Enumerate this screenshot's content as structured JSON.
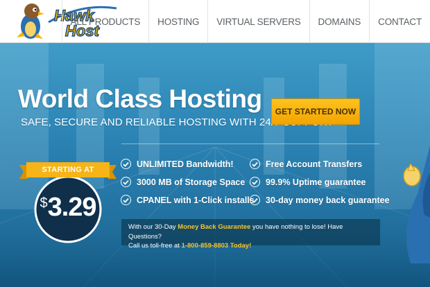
{
  "brand": {
    "name": "Hawk Host",
    "logo_text_line1": "Hawk",
    "logo_text_line2": "Host"
  },
  "nav": [
    {
      "label": "ALL PRODUCTS"
    },
    {
      "label": "HOSTING"
    },
    {
      "label": "VIRTUAL SERVERS"
    },
    {
      "label": "DOMAINS"
    },
    {
      "label": "CONTACT"
    }
  ],
  "hero": {
    "headline": "World Class Hosting",
    "subheadline": "SAFE, SECURE AND RELIABLE HOSTING WITH 24/7 SUPPORT",
    "cta_label": "GET STARTED NOW"
  },
  "pricing": {
    "ribbon": "STARTING AT",
    "currency": "$",
    "amount": "3.29"
  },
  "features": {
    "left": [
      {
        "label": "UNLIMITED Bandwidth!"
      },
      {
        "label": "3000 MB of Storage Space"
      },
      {
        "label": "CPANEL with 1-Click installs"
      }
    ],
    "right": [
      {
        "label": "Free Account Transfers"
      },
      {
        "label": "99.9% Uptime guarantee"
      },
      {
        "label": "30-day money back guarantee"
      }
    ]
  },
  "guarantee": {
    "line1_prefix": "With our 30-Day ",
    "line1_highlight": "Money Back Guarantee",
    "line1_suffix": " you have nothing to lose! Have Questions?",
    "line2_prefix": "Call us toll-free at ",
    "line2_highlight": "1-800-859-8803 Today!"
  },
  "colors": {
    "accent_yellow": "#f6c42d",
    "cta_bg": "#ffb80f",
    "hero_blue": "#2d86b6",
    "badge_navy": "#0f2f4a"
  }
}
